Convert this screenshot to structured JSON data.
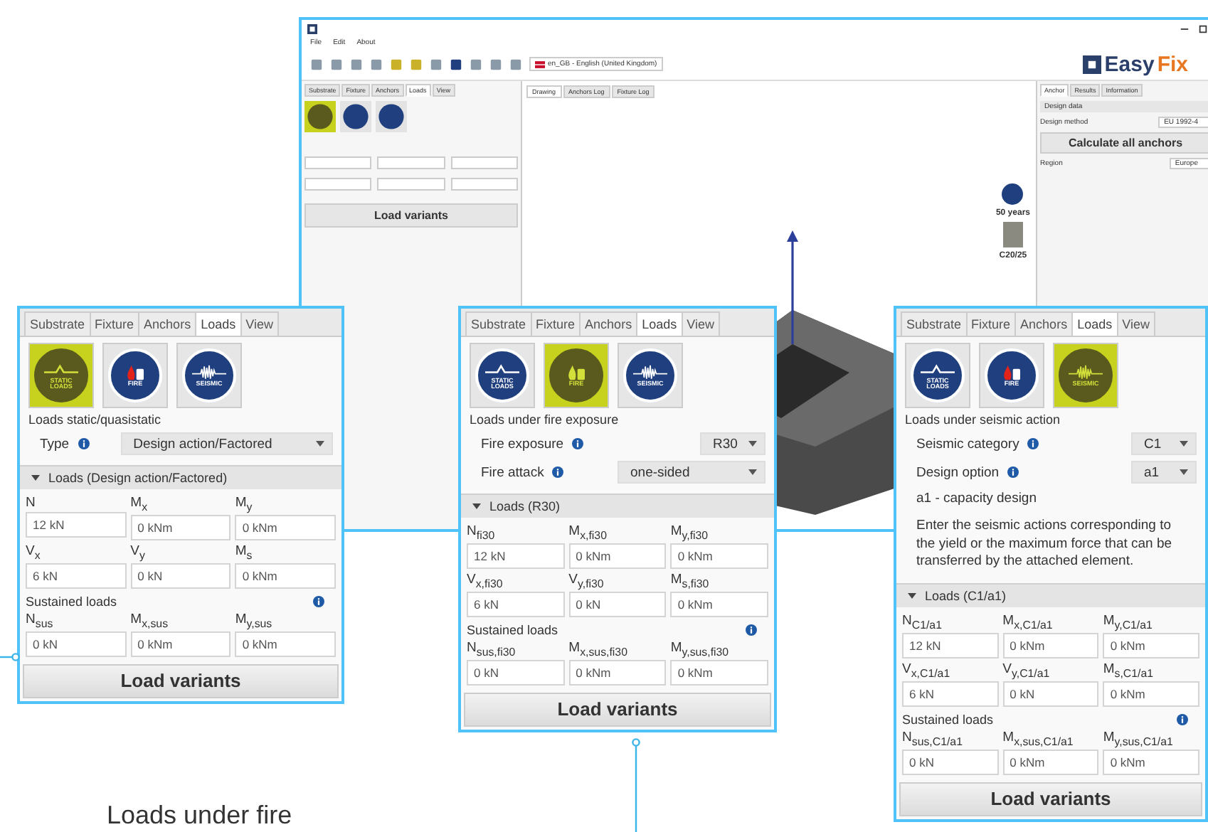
{
  "app_window": {
    "menu": [
      "File",
      "Edit",
      "About"
    ],
    "language": "en_GB - English (United Kingdom)",
    "left_tabs": [
      {
        "label": "Substrate",
        "selected": false
      },
      {
        "label": "Fixture",
        "selected": false
      },
      {
        "label": "Anchors",
        "selected": false
      },
      {
        "label": "Loads",
        "selected": true
      },
      {
        "label": "View",
        "selected": false
      }
    ],
    "left_button": "Load variants",
    "view_tabs": [
      {
        "label": "Drawing",
        "selected": true
      },
      {
        "label": "Anchors Log",
        "selected": false
      },
      {
        "label": "Fixture Log",
        "selected": false
      }
    ],
    "logo_a": "Easy",
    "logo_b": "Fix",
    "right_tabs": [
      {
        "label": "Anchor",
        "selected": true
      },
      {
        "label": "Results",
        "selected": false
      },
      {
        "label": "Information",
        "selected": false
      }
    ],
    "design_data": "Design data",
    "design_method": "Design method",
    "design_method_value": "EU 1992-4",
    "calculate_button": "Calculate all anchors",
    "region": "Region",
    "region_value": "Europe",
    "working_life": "50 years",
    "concrete": "C20/25"
  },
  "panels": [
    {
      "tabs": [
        {
          "label": "Substrate",
          "selected": false
        },
        {
          "label": "Fixture",
          "selected": false
        },
        {
          "label": "Anchors",
          "selected": false
        },
        {
          "label": "Loads",
          "selected": true
        },
        {
          "label": "View",
          "selected": false
        }
      ],
      "load_types": [
        {
          "kind": "static",
          "label": "STATIC LOADS",
          "selected": true
        },
        {
          "kind": "fire",
          "label": "FIRE",
          "selected": false
        },
        {
          "kind": "seismic",
          "label": "SEISMIC",
          "selected": false
        }
      ],
      "title": "Loads static/quasistatic",
      "settings": [
        {
          "kind": "wide",
          "label": "Type",
          "value": "Design action/Factored"
        }
      ],
      "loads": {
        "title": "Loads (Design action/Factored)",
        "expanded": true,
        "fields": [
          {
            "label": "N",
            "value": "12 kN"
          },
          {
            "label": "M$_{x}$",
            "value": "0 kNm"
          },
          {
            "label": "M$_{y}$",
            "value": "0 kNm"
          },
          {
            "label": "V$_{x}$",
            "value": "6 kN"
          },
          {
            "label": "V$_{y}$",
            "value": "0 kN"
          },
          {
            "label": "M$_{s}$",
            "value": "0 kNm"
          }
        ],
        "sustained_label": "Sustained loads",
        "sustained_fields": [
          {
            "label": "N$_{sus}$",
            "value": "0 kN"
          },
          {
            "label": "M$_{x,sus}$",
            "value": "0 kNm"
          },
          {
            "label": "M$_{y,sus}$",
            "value": "0 kNm"
          }
        ]
      },
      "button": "Load variants"
    },
    {
      "tabs": [
        {
          "label": "Substrate",
          "selected": false
        },
        {
          "label": "Fixture",
          "selected": false
        },
        {
          "label": "Anchors",
          "selected": false
        },
        {
          "label": "Loads",
          "selected": true
        },
        {
          "label": "View",
          "selected": false
        }
      ],
      "load_types": [
        {
          "kind": "static",
          "label": "STATIC LOADS",
          "selected": false
        },
        {
          "kind": "fire",
          "label": "FIRE",
          "selected": true
        },
        {
          "kind": "seismic",
          "label": "SEISMIC",
          "selected": false
        }
      ],
      "title": "Loads under fire exposure",
      "settings": [
        {
          "kind": "compact",
          "label": "Fire exposure",
          "value": "R30"
        },
        {
          "kind": "medium",
          "label": "Fire attack",
          "value": "one-sided"
        }
      ],
      "loads": {
        "title": "Loads (R30)",
        "expanded": true,
        "fields": [
          {
            "label": "N$_{fi30}$",
            "value": "12 kN"
          },
          {
            "label": "M$_{x,fi30}$",
            "value": "0 kNm"
          },
          {
            "label": "M$_{y,fi30}$",
            "value": "0 kNm"
          },
          {
            "label": "V$_{x,fi30}$",
            "value": "6 kN"
          },
          {
            "label": "V$_{y,fi30}$",
            "value": "0 kN"
          },
          {
            "label": "M$_{s,fi30}$",
            "value": "0 kNm"
          }
        ],
        "sustained_label": "Sustained loads",
        "sustained_fields": [
          {
            "label": "N$_{sus,fi30}$",
            "value": "0 kN"
          },
          {
            "label": "M$_{x,sus,fi30}$",
            "value": "0 kNm"
          },
          {
            "label": "M$_{y,sus,fi30}$",
            "value": "0 kNm"
          }
        ]
      },
      "button": "Load variants"
    },
    {
      "tabs": [
        {
          "label": "Substrate",
          "selected": false
        },
        {
          "label": "Fixture",
          "selected": false
        },
        {
          "label": "Anchors",
          "selected": false
        },
        {
          "label": "Loads",
          "selected": true
        },
        {
          "label": "View",
          "selected": false
        }
      ],
      "load_types": [
        {
          "kind": "static",
          "label": "STATIC LOADS",
          "selected": false
        },
        {
          "kind": "fire",
          "label": "FIRE",
          "selected": false
        },
        {
          "kind": "seismic",
          "label": "SEISMIC",
          "selected": true
        }
      ],
      "title": "Loads under seismic action",
      "settings": [
        {
          "kind": "compact",
          "label": "Seismic category",
          "value": "C1"
        },
        {
          "kind": "compact",
          "label": "Design option",
          "value": "a1"
        }
      ],
      "notes": [
        "a1 - capacity design",
        "Enter the seismic actions corresponding to the yield or the maximum force that can be transferred by the attached element."
      ],
      "loads": {
        "title": "Loads (C1/a1)",
        "expanded": true,
        "fields": [
          {
            "label": "N$_{C1/a1}$",
            "value": "12 kN"
          },
          {
            "label": "M$_{x,C1/a1}$",
            "value": "0 kNm"
          },
          {
            "label": "M$_{y,C1/a1}$",
            "value": "0 kNm"
          },
          {
            "label": "V$_{x,C1/a1}$",
            "value": "6 kN"
          },
          {
            "label": "V$_{y,C1/a1}$",
            "value": "0 kN"
          },
          {
            "label": "M$_{s,C1/a1}$",
            "value": "0 kNm"
          }
        ],
        "sustained_label": "Sustained loads",
        "sustained_fields": [
          {
            "label": "N$_{sus,C1/a1}$",
            "value": "0 kN"
          },
          {
            "label": "M$_{x,sus,C1/a1}$",
            "value": "0 kNm"
          },
          {
            "label": "M$_{y,sus,C1/a1}$",
            "value": "0 kNm"
          }
        ]
      },
      "button": "Load variants"
    }
  ],
  "caption": "Loads under fire"
}
